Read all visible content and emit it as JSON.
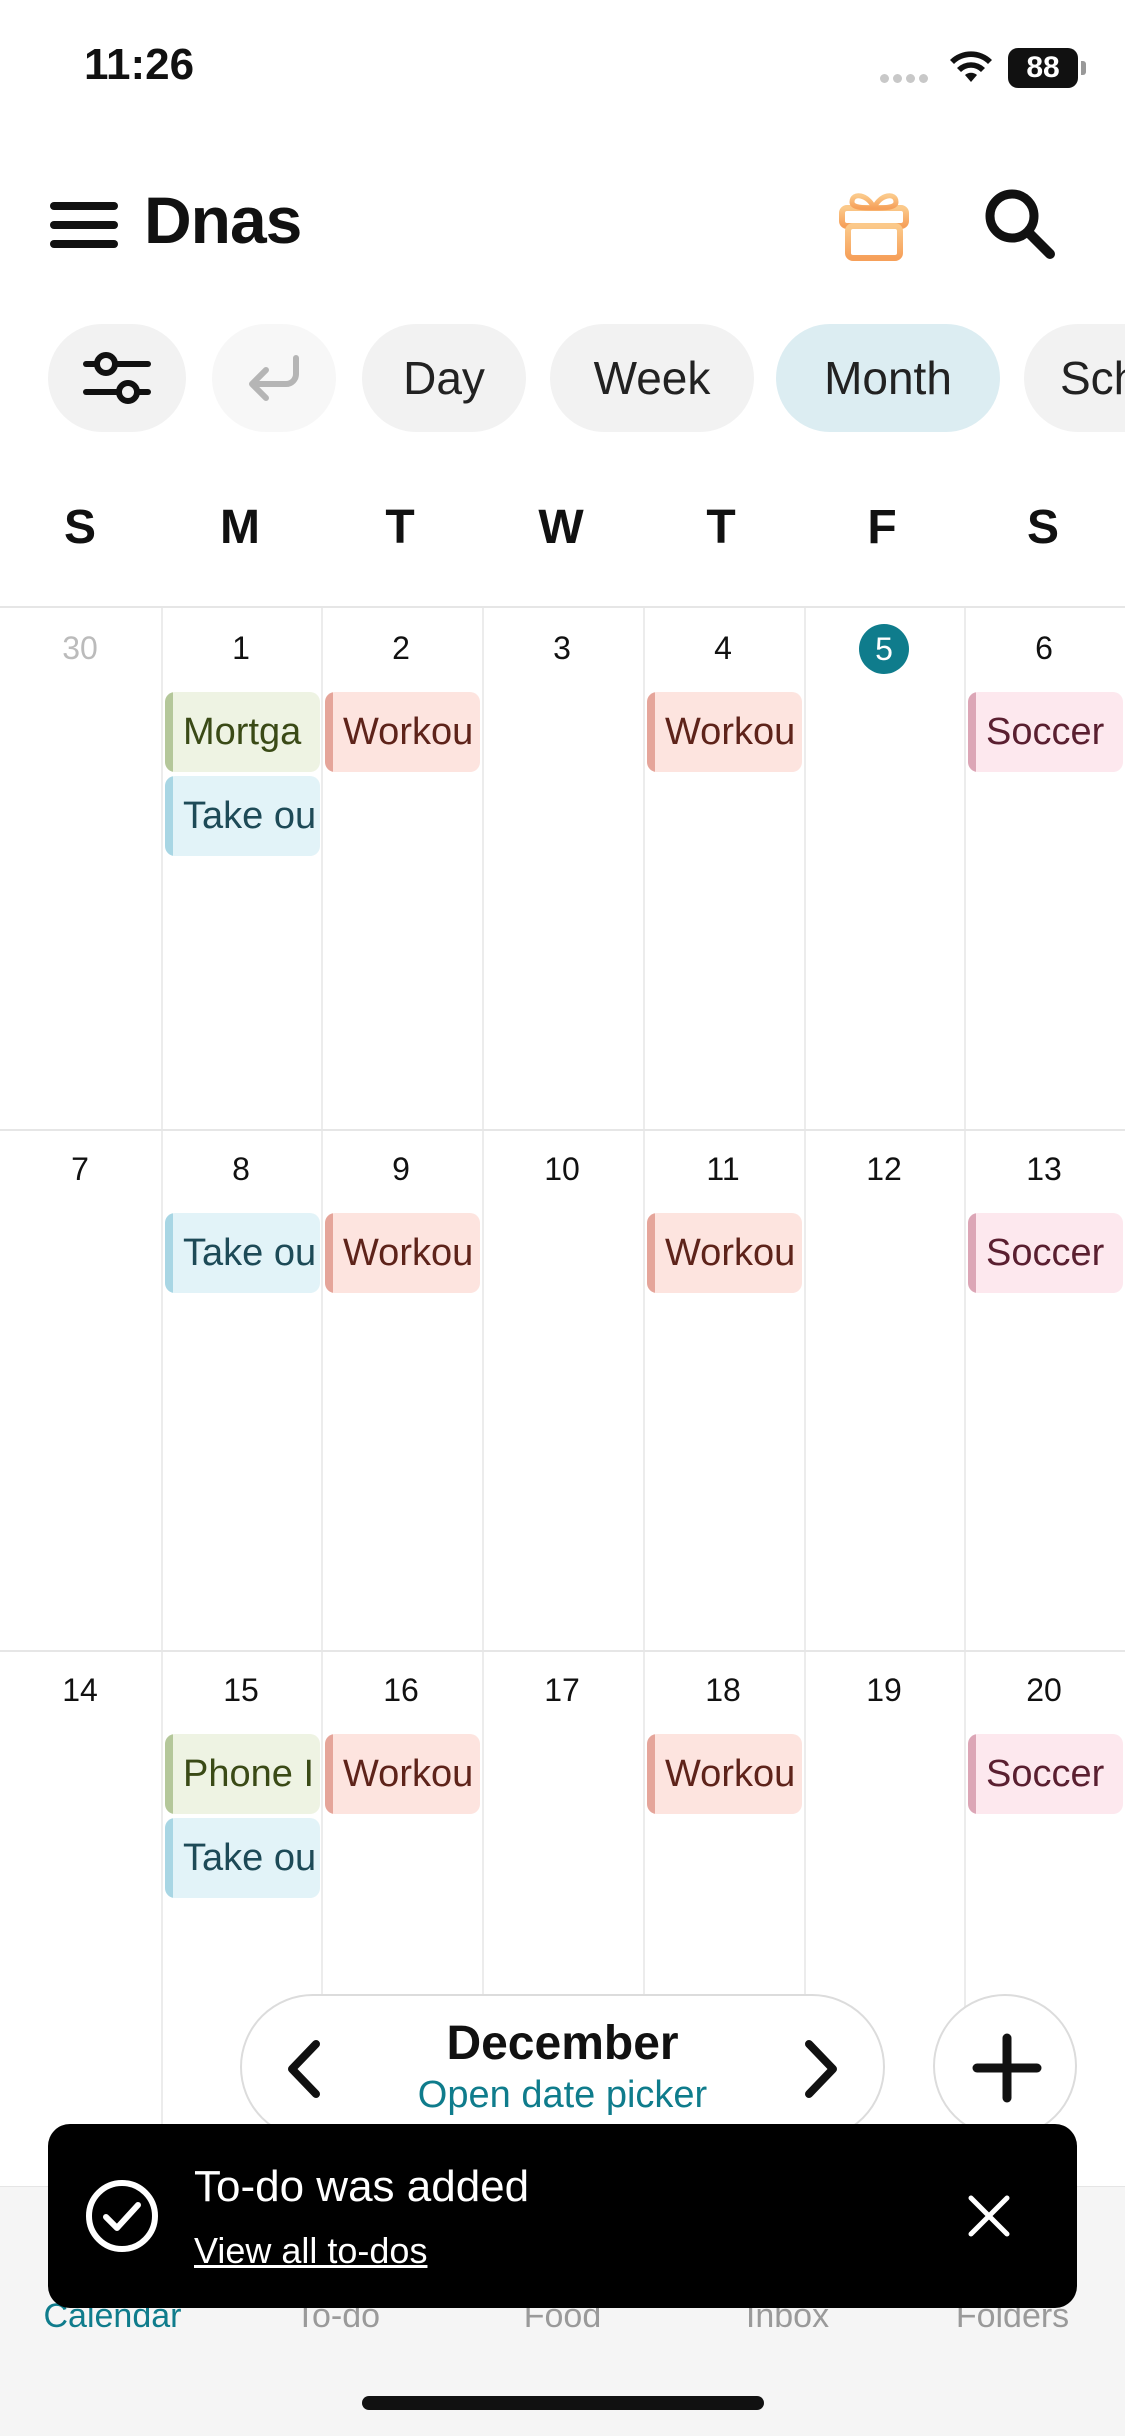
{
  "status_bar": {
    "time": "11:26",
    "battery": "88"
  },
  "header": {
    "title": "Dnas"
  },
  "view_chips": [
    "Day",
    "Week",
    "Month",
    "Sch"
  ],
  "active_view": "Month",
  "weekdays": [
    "S",
    "M",
    "T",
    "W",
    "T",
    "F",
    "S"
  ],
  "weeks": [
    {
      "days": [
        "30",
        "1",
        "2",
        "3",
        "4",
        "5",
        "6"
      ],
      "events": [
        {
          "col": 1,
          "slot": 0,
          "label": "Mortga",
          "color": "green"
        },
        {
          "col": 1,
          "slot": 1,
          "label": "Take ou",
          "color": "blue"
        },
        {
          "col": 2,
          "slot": 0,
          "label": "Workou",
          "color": "salmon"
        },
        {
          "col": 4,
          "slot": 0,
          "label": "Workou",
          "color": "salmon"
        },
        {
          "col": 6,
          "slot": 0,
          "label": "Soccer",
          "color": "pink"
        }
      ]
    },
    {
      "days": [
        "7",
        "8",
        "9",
        "10",
        "11",
        "12",
        "13"
      ],
      "events": [
        {
          "col": 1,
          "slot": 0,
          "label": "Take ou",
          "color": "blue"
        },
        {
          "col": 2,
          "slot": 0,
          "label": "Workou",
          "color": "salmon"
        },
        {
          "col": 4,
          "slot": 0,
          "label": "Workou",
          "color": "salmon"
        },
        {
          "col": 6,
          "slot": 0,
          "label": "Soccer",
          "color": "pink"
        }
      ]
    },
    {
      "days": [
        "14",
        "15",
        "16",
        "17",
        "18",
        "19",
        "20"
      ],
      "events": [
        {
          "col": 1,
          "slot": 0,
          "label": "Phone I",
          "color": "green"
        },
        {
          "col": 1,
          "slot": 1,
          "label": "Take ou",
          "color": "blue"
        },
        {
          "col": 2,
          "slot": 0,
          "label": "Workou",
          "color": "salmon"
        },
        {
          "col": 4,
          "slot": 0,
          "label": "Workou",
          "color": "salmon"
        },
        {
          "col": 6,
          "slot": 0,
          "label": "Soccer",
          "color": "pink"
        }
      ]
    }
  ],
  "today": "5",
  "month_nav": {
    "month": "December",
    "picker_label": "Open date picker"
  },
  "toast": {
    "message": "To-do was added",
    "link": "View all to-dos"
  },
  "tabs": [
    "Calendar",
    "To-do",
    "Food",
    "Inbox",
    "Folders"
  ],
  "active_tab": "Calendar",
  "colors": {
    "accent": "#0f7c8c",
    "active_chip": "#dcedf2"
  }
}
